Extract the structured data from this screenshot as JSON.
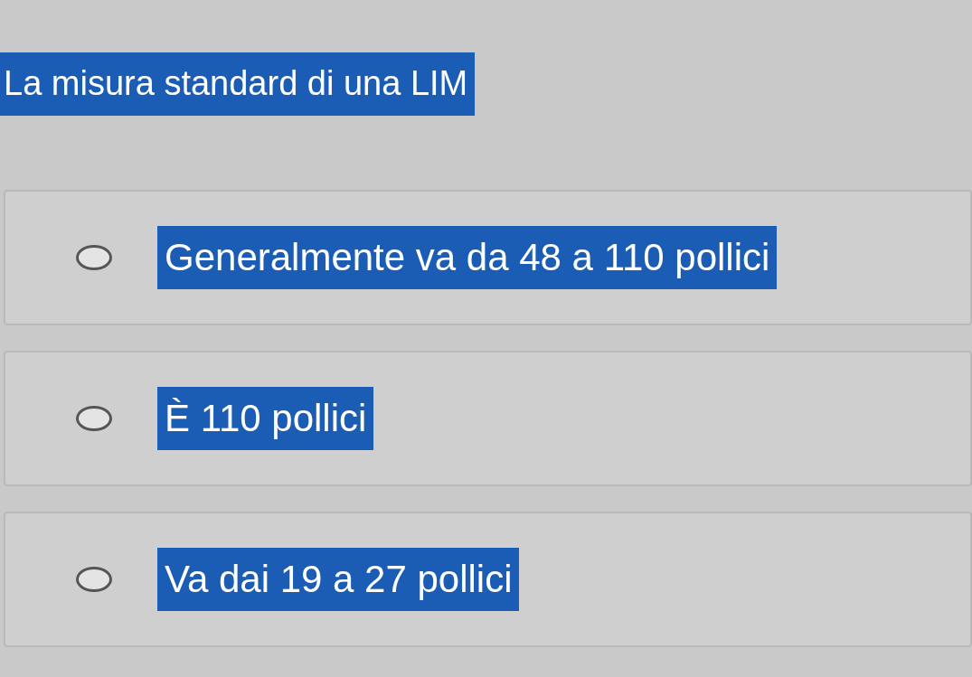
{
  "question": {
    "text": "La misura standard di una LIM"
  },
  "options": [
    {
      "label": "Generalmente va da 48 a 110 pollici",
      "selected": false
    },
    {
      "label": "È 110 pollici",
      "selected": false
    },
    {
      "label": "Va dai 19 a 27 pollici",
      "selected": false
    }
  ]
}
